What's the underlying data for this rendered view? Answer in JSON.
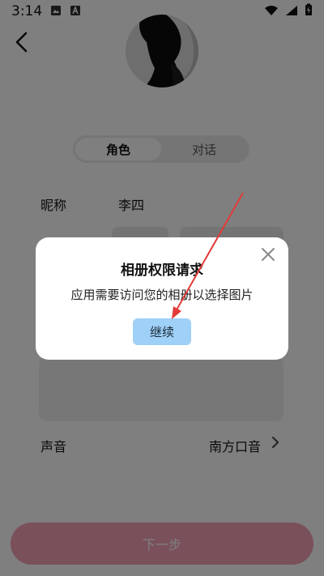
{
  "status_bar": {
    "time": "3:14"
  },
  "profile": {
    "tabs": [
      {
        "label": "角色",
        "active": true
      },
      {
        "label": "对话",
        "active": false
      }
    ],
    "nickname_label": "昵称",
    "nickname_value": "李四",
    "voice_label": "声音",
    "voice_value": "南方口音"
  },
  "footer": {
    "next_label": "下一步"
  },
  "dialog": {
    "title": "相册权限请求",
    "message": "应用需要访问您的相册以选择图片",
    "continue_label": "继续"
  },
  "colors": {
    "dialog_button": "#9fd0f7",
    "next_button": "#f4a0b6",
    "arrow": "#e33a3a"
  }
}
